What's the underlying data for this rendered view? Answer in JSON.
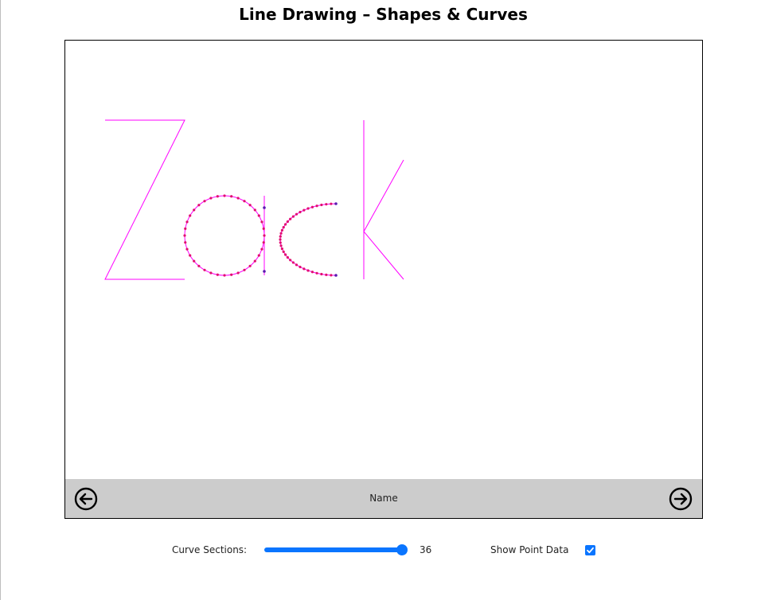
{
  "title": "Line Drawing – Shapes & Curves",
  "nav": {
    "label": "Name",
    "prev_icon": "arrow-left-circle-icon",
    "next_icon": "arrow-right-circle-icon"
  },
  "controls": {
    "curve_sections_label": "Curve Sections:",
    "curve_sections_value": "36",
    "curve_sections_fraction": 1.0,
    "show_point_data_label": "Show Point Data",
    "show_point_data_checked": true
  },
  "colors": {
    "line": "#ff00ff",
    "curve_point": "#e0106e",
    "endpoint": "#5a1ab0",
    "accent": "#0a75ff",
    "nav_bar": "#cccccc"
  }
}
